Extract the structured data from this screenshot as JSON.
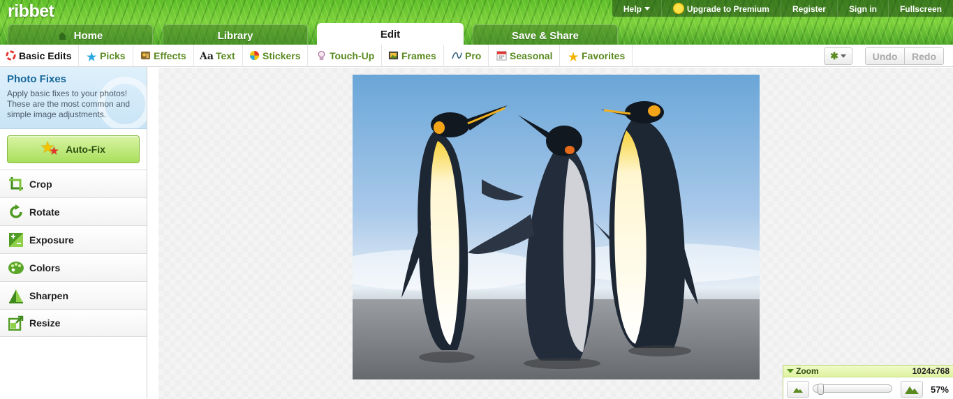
{
  "app": {
    "logo": "ribbet"
  },
  "top_nav": {
    "help": "Help",
    "upgrade": "Upgrade to Premium",
    "register": "Register",
    "sign_in": "Sign in",
    "fullscreen": "Fullscreen"
  },
  "main_tabs": [
    {
      "label": "Home",
      "active": false
    },
    {
      "label": "Library",
      "active": false
    },
    {
      "label": "Edit",
      "active": true
    },
    {
      "label": "Save & Share",
      "active": false
    }
  ],
  "sub_nav": [
    {
      "label": "Basic Edits",
      "icon": "basic-edits-icon",
      "active": true
    },
    {
      "label": "Picks",
      "icon": "star-icon",
      "active": false
    },
    {
      "label": "Effects",
      "icon": "effects-icon",
      "active": false
    },
    {
      "label": "Text",
      "icon": "text-icon",
      "active": false
    },
    {
      "label": "Stickers",
      "icon": "stickers-icon",
      "active": false
    },
    {
      "label": "Touch-Up",
      "icon": "touch-up-icon",
      "active": false
    },
    {
      "label": "Frames",
      "icon": "frames-icon",
      "active": false
    },
    {
      "label": "Pro",
      "icon": "pro-curve-icon",
      "active": false
    },
    {
      "label": "Seasonal",
      "icon": "calendar-icon",
      "active": false
    },
    {
      "label": "Favorites",
      "icon": "star-icon",
      "active": false
    }
  ],
  "text_icon_glyph": "Aa",
  "toolbar": {
    "undo": "Undo",
    "redo": "Redo"
  },
  "sidebar": {
    "section_title": "Photo Fixes",
    "section_desc": "Apply basic fixes to your photos! These are the most common and simple image adjustments.",
    "autofix": "Auto-Fix",
    "tools": [
      {
        "label": "Crop",
        "icon": "crop-icon"
      },
      {
        "label": "Rotate",
        "icon": "rotate-icon"
      },
      {
        "label": "Exposure",
        "icon": "exposure-icon"
      },
      {
        "label": "Colors",
        "icon": "palette-icon"
      },
      {
        "label": "Sharpen",
        "icon": "sharpen-icon"
      },
      {
        "label": "Resize",
        "icon": "resize-icon"
      }
    ]
  },
  "zoom": {
    "label": "Zoom",
    "dimensions": "1024x768",
    "percent": "57%",
    "level": 0.57
  },
  "colors": {
    "accent_green": "#5a8a1f",
    "title_blue": "#16679b"
  }
}
